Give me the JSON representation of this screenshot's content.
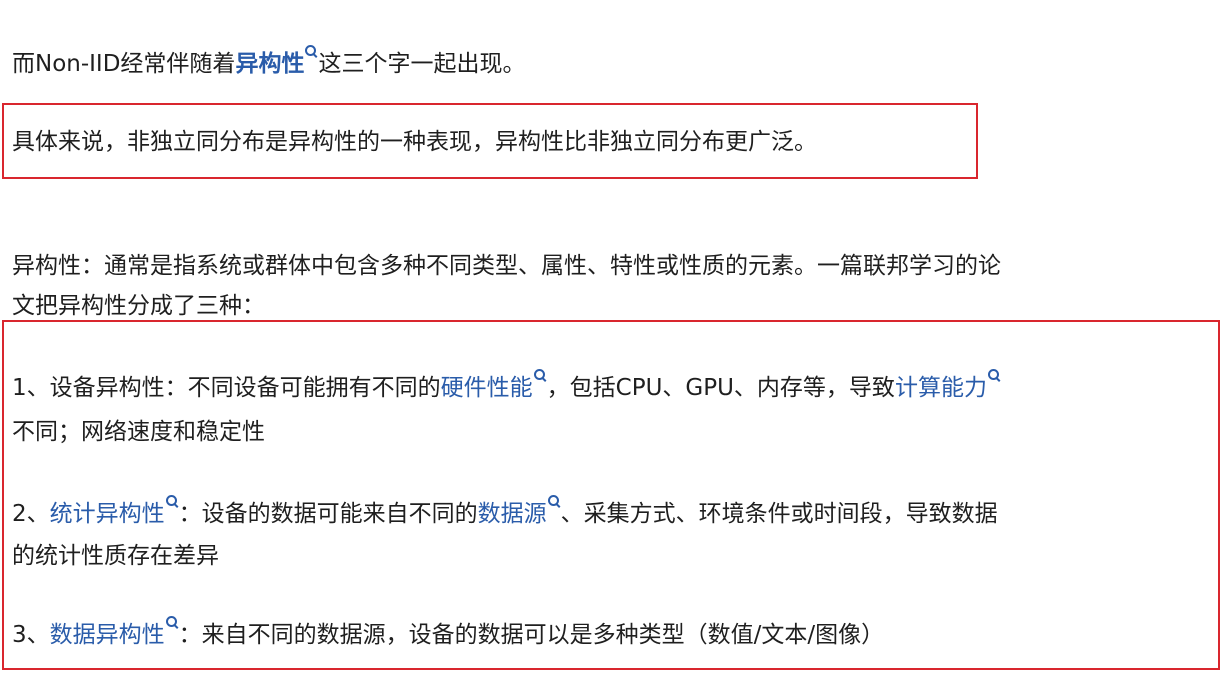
{
  "para1": {
    "prefix": "而Non-IID经常伴随着",
    "link": "异构性",
    "suffix": "这三个字一起出现。"
  },
  "para2": {
    "text": "具体来说，非独立同分布是异构性的一种表现，异构性比非独立同分布更广泛。"
  },
  "para3": {
    "line1": "异构性：通常是指系统或群体中包含多种不同类型、属性、特性或性质的元素。一篇联邦学习的论",
    "line2": "文把异构性分成了三种："
  },
  "item1": {
    "prefix": "1、设备异构性：不同设备可能拥有不同的",
    "link1": "硬件性能",
    "middle": "，包括CPU、GPU、内存等，导致",
    "link2": "计算能力",
    "line2": "不同；网络速度和稳定性"
  },
  "item2": {
    "prefix": "2、",
    "link1": "统计异构性",
    "middle": "：设备的数据可能来自不同的",
    "link2": "数据源",
    "suffix": "、采集方式、环境条件或时间段，导致数据",
    "line2": "的统计性质存在差异"
  },
  "item3": {
    "prefix": "3、",
    "link1": "数据异构性",
    "suffix": "：来自不同的数据源，设备的数据可以是多种类型（数值/文本/图像）"
  },
  "colors": {
    "link": "#2a5caa",
    "highlight_box": "#d9262e",
    "text": "#1f1f1f"
  }
}
